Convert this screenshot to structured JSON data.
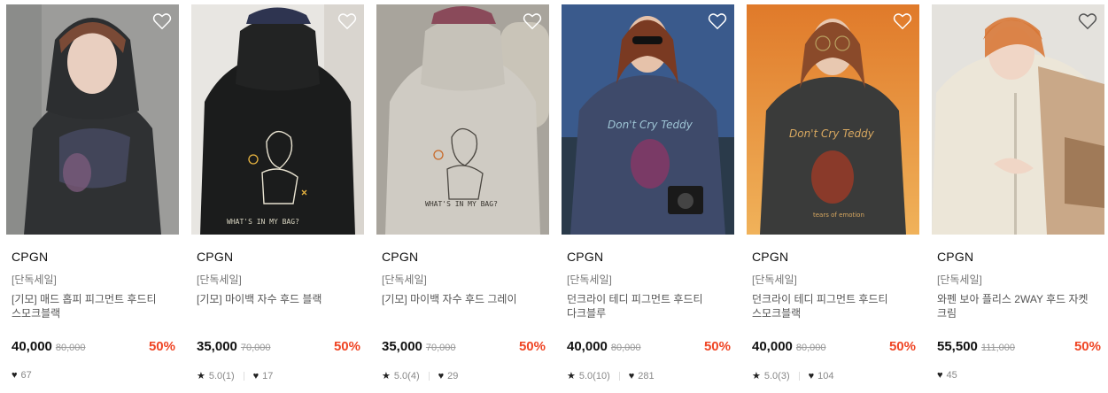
{
  "products": [
    {
      "brand": "CPGN",
      "tag": "[단독세일]",
      "name": "[기모] 매드 홉피 피그먼트 후드티 스모크블랙",
      "price": "40,000",
      "original_price": "80,000",
      "discount": "50%",
      "rating": "",
      "likes": "67",
      "hoodie_color": "#2f3133",
      "bg_color": "#9c9c9a"
    },
    {
      "brand": "CPGN",
      "tag": "[단독세일]",
      "name": "[기모] 마이백 자수 후드 블랙",
      "price": "35,000",
      "original_price": "70,000",
      "discount": "50%",
      "rating": "5.0(1)",
      "likes": "17",
      "hoodie_color": "#1b1c1c",
      "bg_color": "#e8e6e2"
    },
    {
      "brand": "CPGN",
      "tag": "[단독세일]",
      "name": "[기모] 마이백 자수 후드 그레이",
      "price": "35,000",
      "original_price": "70,000",
      "discount": "50%",
      "rating": "5.0(4)",
      "likes": "29",
      "hoodie_color": "#cfcbc3",
      "bg_color": "#a8a49c"
    },
    {
      "brand": "CPGN",
      "tag": "[단독세일]",
      "name": "던크라이 테디 피그먼트 후드티 다크블루",
      "price": "40,000",
      "original_price": "80,000",
      "discount": "50%",
      "rating": "5.0(10)",
      "likes": "281",
      "hoodie_color": "#3e4a6a",
      "bg_color": "#3a5a8c"
    },
    {
      "brand": "CPGN",
      "tag": "[단독세일]",
      "name": "던크라이 테디 피그먼트 후드티 스모크블랙",
      "price": "40,000",
      "original_price": "80,000",
      "discount": "50%",
      "rating": "5.0(3)",
      "likes": "104",
      "hoodie_color": "#3a3b3a",
      "bg_color": "#d88a3c"
    },
    {
      "brand": "CPGN",
      "tag": "[단독세일]",
      "name": "와펜 보아 플리스 2WAY 후드 자켓 크림",
      "price": "55,500",
      "original_price": "111,000",
      "discount": "50%",
      "rating": "",
      "likes": "45",
      "hoodie_color": "#ece6d8",
      "bg_color": "#e4e2dd"
    }
  ]
}
